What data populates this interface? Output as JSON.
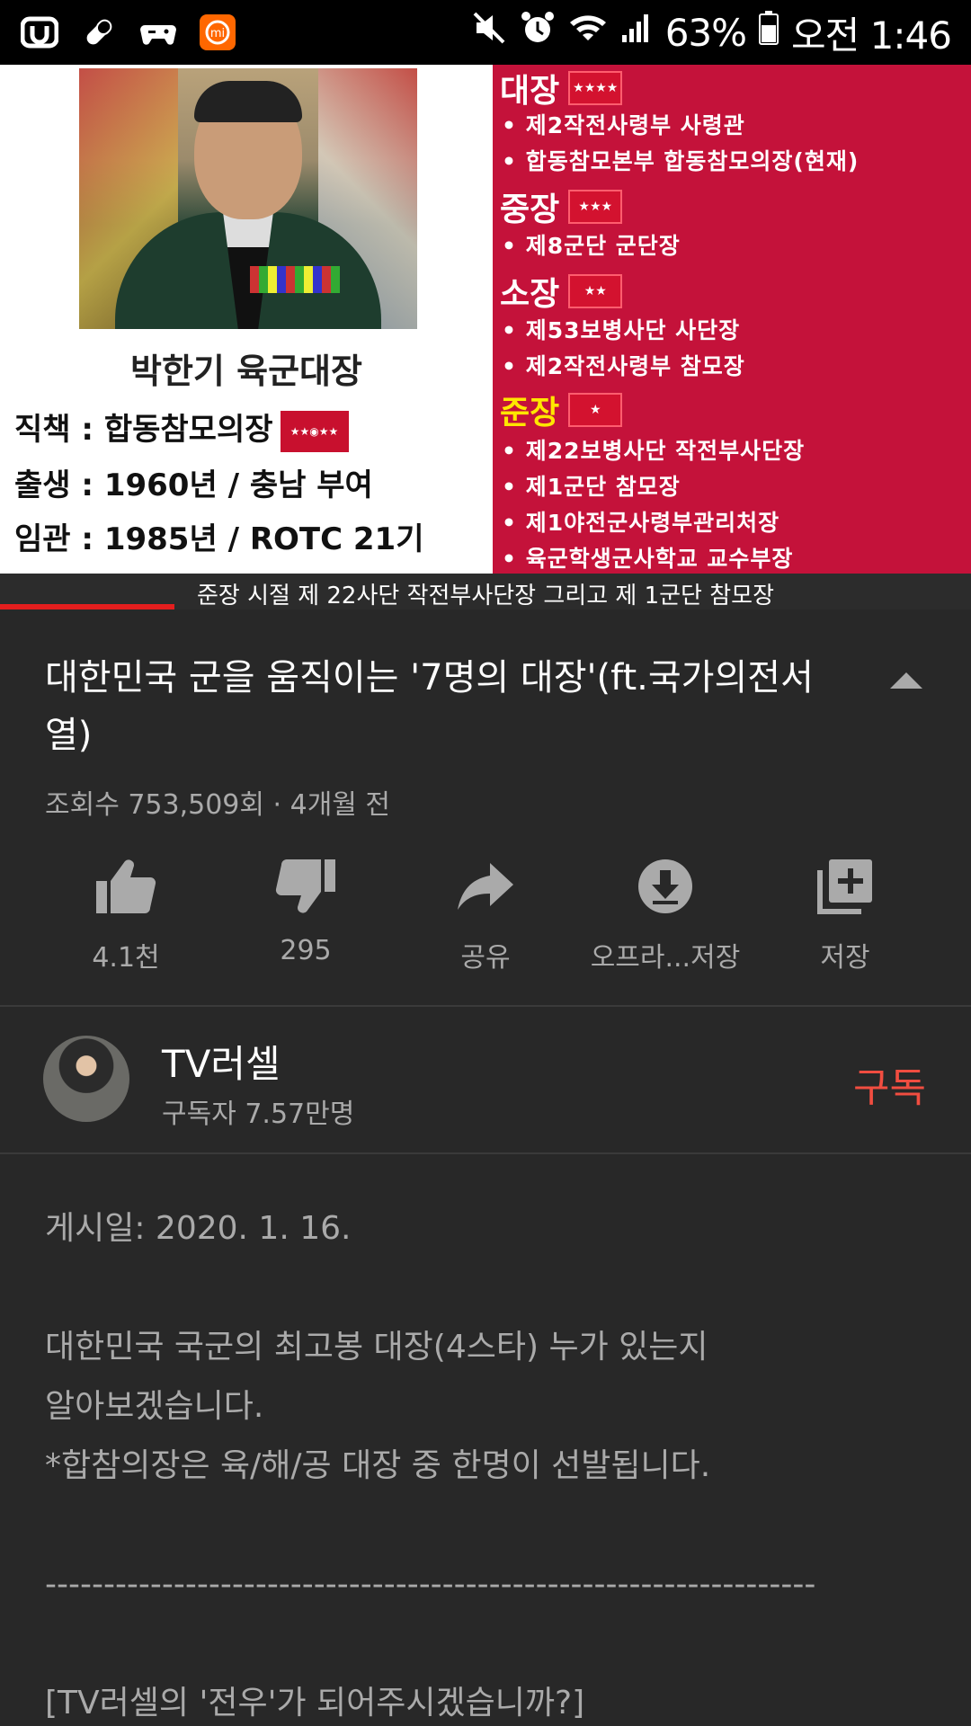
{
  "status_bar": {
    "battery": "63%",
    "time": "오전 1:46"
  },
  "video": {
    "left_panel": {
      "name": "박한기 육군대장",
      "position": "직책 : 합동참모의장",
      "birth": "출생 : 1960년 / 충남 부여",
      "commission": "임관 : 1985년 / ROTC 21기"
    },
    "right_panel": {
      "ranks": [
        {
          "rank": "대장",
          "items": [
            "제2작전사령부 사령관",
            "합동참모본부 합동참모의장(현재)"
          ]
        },
        {
          "rank": "중장",
          "items": [
            "제8군단 군단장"
          ]
        },
        {
          "rank": "소장",
          "items": [
            "제53보병사단 사단장",
            "제2작전사령부 참모장"
          ]
        },
        {
          "rank": "준장",
          "items": [
            "제22보병사단 작전부사단장",
            "제1군단 참모장",
            "제1야전군사령부관리처장",
            "육군학생군사학교 교수부장"
          ]
        }
      ]
    },
    "subtitle": "준장 시절 제 22사단 작전부사단장 그리고 제 1군단 참모장",
    "progress": 0.18
  },
  "details": {
    "title": "대한민국 군을 움직이는 '7명의 대장'(ft.국가의전서열)",
    "meta": "조회수 753,509회 · 4개월 전"
  },
  "actions": {
    "like": "4.1천",
    "dislike": "295",
    "share": "공유",
    "download": "오프라...저장",
    "save": "저장"
  },
  "channel": {
    "name": "TV러셀",
    "subscribers": "구독자 7.57만명",
    "subscribe_label": "구독"
  },
  "description": {
    "text": "게시일: 2020. 1. 16.\n\n대한민국 국군의 최고봉 대장(4스타) 누가 있는지\n알아보겠습니다.\n*합참의장은 육/해/공 대장 중 한명이 선발됩니다.\n\n------------------------------------------------------------------\n\n[TV러셀의 '전우'가 되어주시겠습니까?]"
  }
}
